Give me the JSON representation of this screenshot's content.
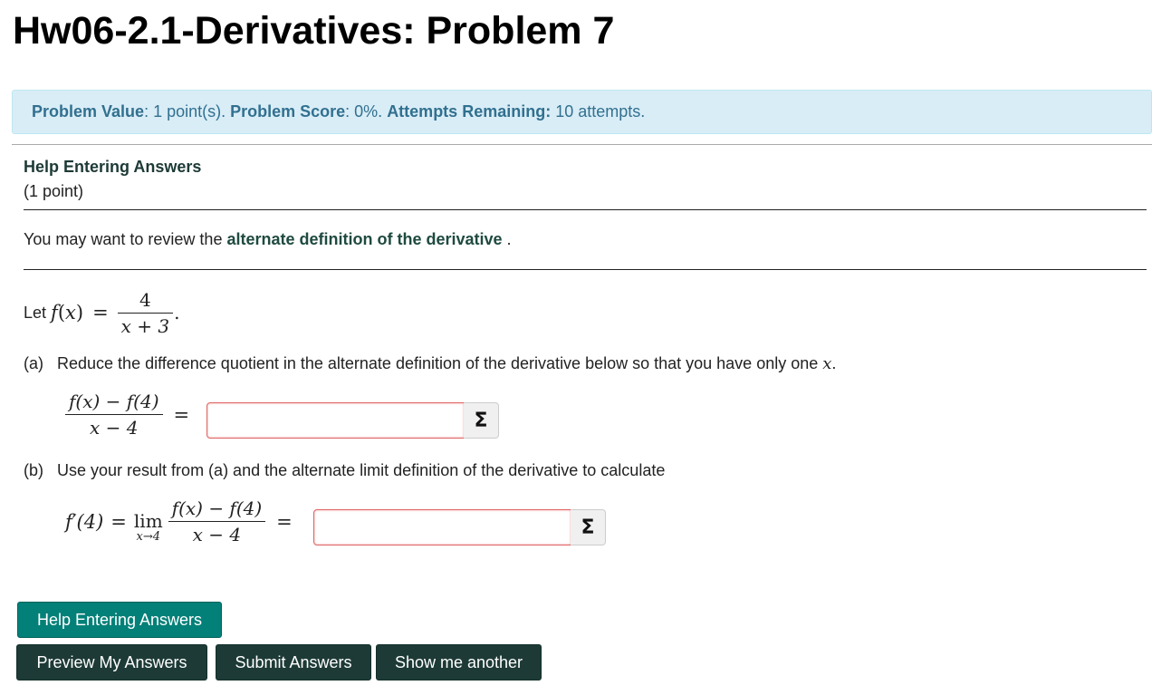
{
  "page": {
    "title": "Hw06-2.1-Derivatives: Problem 7"
  },
  "info": {
    "value_label": "Problem Value",
    "value_text": ": 1 point(s). ",
    "score_label": "Problem Score",
    "score_text": ": 0%. ",
    "attempts_label": "Attempts Remaining:",
    "attempts_text": " 10 attempts.",
    "colors": {
      "background": "#d9edf7",
      "text": "#31708f"
    }
  },
  "problem": {
    "help_heading": "Help Entering Answers",
    "points": "(1 point)",
    "review_prefix": "You may want to review the ",
    "review_link": "alternate definition of the derivative",
    "review_suffix": " .",
    "let_prefix": "Let ",
    "function": {
      "name": "f",
      "var": "x",
      "numerator": "4",
      "denominator": "x + 3"
    },
    "part_a": {
      "label": "(a)",
      "text": "Reduce the difference quotient in the alternate definition of the derivative below so that you have only one ",
      "var": "x",
      "end": ".",
      "quotient_num": "f(x) − f(4)",
      "quotient_den": "x − 4",
      "answer_value": "",
      "answer_placeholder": ""
    },
    "part_b": {
      "label": "(b)",
      "text": "Use your result from (a) and the alternate limit definition of the derivative to calculate",
      "lhs": "f′(4)",
      "lim": "lim",
      "lim_sub": "x→4",
      "quotient_num": "f(x) − f(4)",
      "quotient_den": "x − 4",
      "answer_value": "",
      "answer_placeholder": ""
    },
    "equals": "="
  },
  "equation_editor": {
    "icon": "sigma-icon",
    "glyph": "Σ"
  },
  "buttons": {
    "help": "Help Entering Answers",
    "preview": "Preview My Answers",
    "submit": "Submit Answers",
    "another": "Show me another",
    "colors": {
      "help": "#038078",
      "primary": "#1d3a36"
    }
  }
}
